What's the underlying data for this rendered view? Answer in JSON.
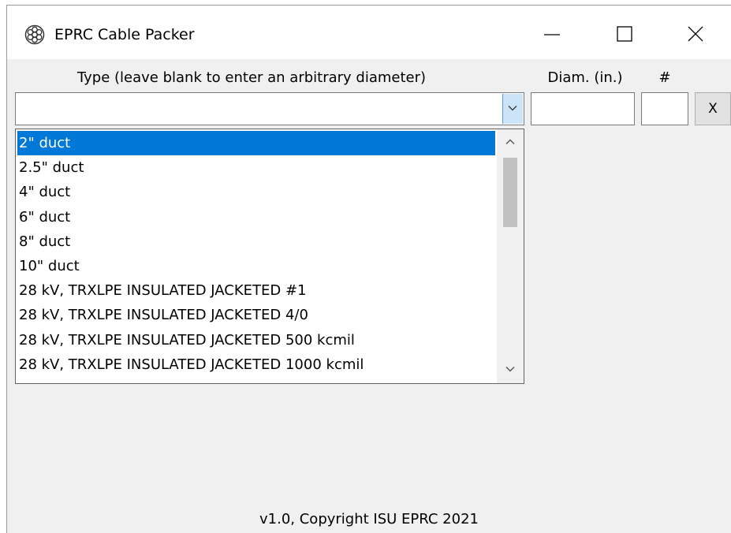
{
  "window": {
    "title": "EPRC Cable Packer",
    "icon": "cable-bundle-icon",
    "controls": {
      "minimize": "minimize-icon",
      "maximize": "maximize-icon",
      "close": "close-icon"
    }
  },
  "form": {
    "type_label": "Type (leave blank to enter an arbitrary diameter)",
    "diam_label": "Diam. (in.)",
    "count_label": "#",
    "type_value": "",
    "diam_value": "",
    "count_value": "",
    "remove_label": "X"
  },
  "dropdown": {
    "selected_index": 0,
    "items": [
      "2\" duct",
      "2.5\" duct",
      "4\" duct",
      "6\" duct",
      "8\" duct",
      "10\" duct",
      "28 kV, TRXLPE INSULATED JACKETED #1",
      "28 kV, TRXLPE INSULATED JACKETED 4/0",
      "28 kV, TRXLPE INSULATED JACKETED 500 kcmil",
      "28 kV, TRXLPE INSULATED JACKETED 1000 kcmil"
    ]
  },
  "footer": {
    "text": "v1.0, Copyright ISU EPRC 2021"
  },
  "colors": {
    "selection": "#0078d7",
    "dropdown_button": "#cce4f7",
    "dropdown_button_border": "#569de5",
    "window_bg": "#f0f0f0"
  }
}
